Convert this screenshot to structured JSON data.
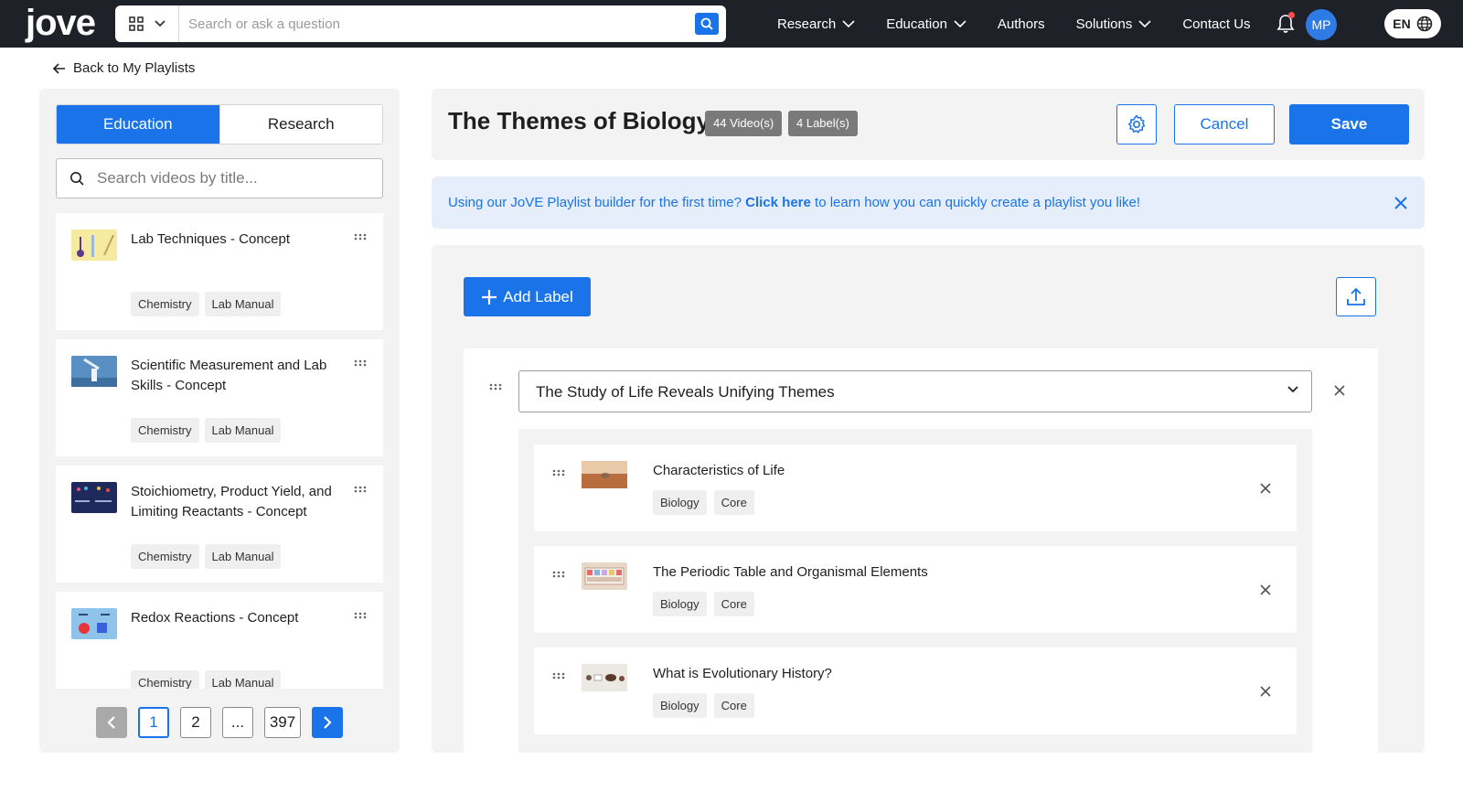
{
  "app": {
    "logo_text": "jove",
    "accent": "#1a73e8"
  },
  "topbar": {
    "search_placeholder": "Search or ask a question",
    "nav": [
      {
        "label": "Research",
        "dropdown": true
      },
      {
        "label": "Education",
        "dropdown": true
      },
      {
        "label": "Authors",
        "dropdown": false
      },
      {
        "label": "Solutions",
        "dropdown": true
      },
      {
        "label": "Contact Us",
        "dropdown": false
      }
    ],
    "avatar_initials": "MP",
    "language": "EN"
  },
  "back_link": "Back to My Playlists",
  "library": {
    "tabs": [
      "Education",
      "Research"
    ],
    "active_tab": "Education",
    "search_placeholder": "Search videos by title...",
    "videos": [
      {
        "title": "Lab Techniques - Concept",
        "tags": [
          "Chemistry",
          "Lab Manual"
        ],
        "thumb_color": "#f6e9a0"
      },
      {
        "title": "Scientific Measurement and Lab Skills - Concept",
        "tags": [
          "Chemistry",
          "Lab Manual"
        ],
        "thumb_color": "#5a8fc4"
      },
      {
        "title": "Stoichiometry, Product Yield, and Limiting Reactants - Concept",
        "tags": [
          "Chemistry",
          "Lab Manual"
        ],
        "thumb_color": "#1f2a5c"
      },
      {
        "title": "Redox Reactions - Concept",
        "tags": [
          "Chemistry",
          "Lab Manual"
        ],
        "thumb_color": "#8ec3ea"
      }
    ],
    "pagination": {
      "current": "1",
      "second": "2",
      "ellipsis": "...",
      "last": "397"
    }
  },
  "playlist": {
    "title": "The Themes of Biology",
    "video_count_badge": "44 Video(s)",
    "label_count_badge": "4 Label(s)",
    "cancel_label": "Cancel",
    "save_label": "Save"
  },
  "banner": {
    "text_before": "Using our JoVE Playlist builder for the first time? ",
    "link_text": "Click here",
    "text_after": " to learn how you can quickly create a playlist you like!"
  },
  "builder": {
    "add_label_text": "Add Label",
    "label_group": {
      "selected": "The Study of Life Reveals Unifying Themes",
      "items": [
        {
          "title": "Characteristics of Life",
          "tags": [
            "Biology",
            "Core"
          ],
          "thumb_color": "#c98a5a"
        },
        {
          "title": "The Periodic Table and Organismal Elements",
          "tags": [
            "Biology",
            "Core"
          ],
          "thumb_color": "#e8d8c8"
        },
        {
          "title": "What is Evolutionary History?",
          "tags": [
            "Biology",
            "Core"
          ],
          "thumb_color": "#d9d4cc"
        }
      ]
    }
  }
}
